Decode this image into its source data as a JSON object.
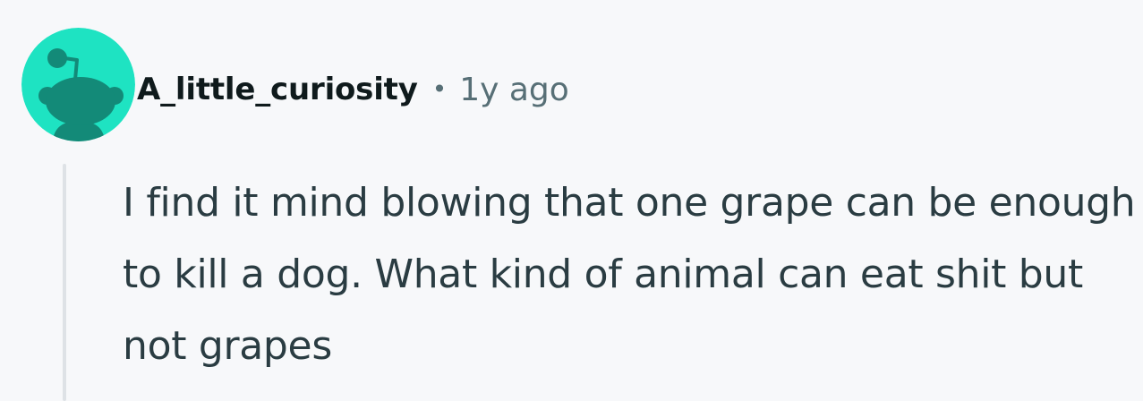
{
  "comment": {
    "author": "A_little_curiosity",
    "separator": "•",
    "timestamp": "1y ago",
    "avatar_icon": "reddit-snoo-avatar-icon",
    "avatar_background": "#1ee3c2",
    "avatar_figure_color": "#138a78",
    "body": "I find it mind blowing that one grape can be enough to kill a dog. What kind of animal can eat shit but not grapes"
  }
}
